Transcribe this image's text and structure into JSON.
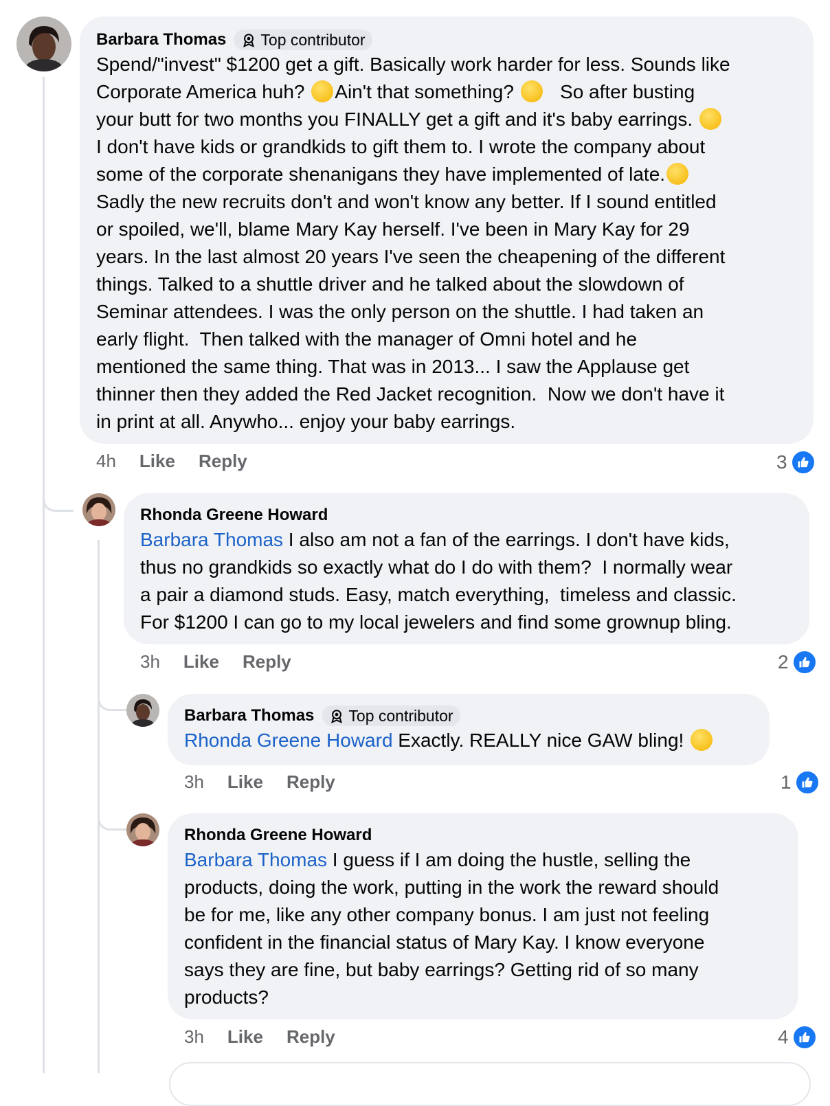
{
  "comments": [
    {
      "author": "Barbara Thomas",
      "badge": "Top contributor",
      "lines": [
        "Spend/\"invest\" $1200 get a gift. Basically work harder for less. Sounds like",
        "Corporate America huh? ",
        "Ain't that something? ",
        "   So after busting",
        "your butt for two months you FINALLY get a gift and it's baby earrings. ",
        "I don't have kids or grandkids to gift them to. I wrote the company about",
        "some of the corporate shenanigans they have implemented of late.",
        "Sadly the new recruits don't and won't know any better. If I sound entitled",
        "or spoiled, we'll, blame Mary Kay herself. I've been in Mary Kay for 29",
        "years. In the last almost 20 years I've seen the cheapening of the different",
        "things. Talked to a shuttle driver and he talked about the slowdown of",
        "Seminar attendees. I was the only person on the shuttle. I had taken an",
        "early flight.  Then talked with the manager of Omni hotel and he",
        "mentioned the same thing. That was in 2013... I saw the Applause get",
        "thinner then they added the Red Jacket recognition.  Now we don't have it",
        "in print at all. Anywho... enjoy your baby earrings."
      ],
      "time": "4h",
      "like": "Like",
      "reply": "Reply",
      "reactions": "3"
    },
    {
      "author": "Rhonda Greene Howard",
      "mention": "Barbara Thomas",
      "lines": [
        " I also am not a fan of the earrings. I don't have kids,",
        "thus no grandkids so exactly what do I do with them?  I normally wear",
        "a pair a diamond studs. Easy, match everything,  timeless and classic.",
        "For $1200 I can go to my local jewelers and find some grownup bling."
      ],
      "time": "3h",
      "like": "Like",
      "reply": "Reply",
      "reactions": "2"
    },
    {
      "author": "Barbara Thomas",
      "badge": "Top contributor",
      "mention": "Rhonda Greene Howard",
      "text": " Exactly. REALLY nice GAW bling! ",
      "time": "3h",
      "like": "Like",
      "reply": "Reply",
      "reactions": "1"
    },
    {
      "author": "Rhonda Greene Howard",
      "mention": "Barbara Thomas",
      "lines": [
        " I guess if I am doing the hustle, selling the",
        "products, doing the work, putting in the work the reward should",
        "be for me, like any other company bonus. I am just not feeling",
        "confident in the financial status of Mary Kay. I know everyone",
        "says they are fine, but baby earrings? Getting rid of so many",
        "products?"
      ],
      "time": "3h",
      "like": "Like",
      "reply": "Reply",
      "reactions": "4"
    }
  ],
  "icons": {
    "badge": "top-contributor-icon",
    "like": "like-thumb-icon",
    "emoji_thinking": "thinking-face-emoji",
    "emoji_laughing": "rolling-laughing-emoji",
    "emoji_eyeroll": "eye-roll-emoji"
  },
  "colors": {
    "bubble": "#f0f2f5",
    "mention": "#1b62c9",
    "like": "#1877f2",
    "meta": "#65676b"
  }
}
